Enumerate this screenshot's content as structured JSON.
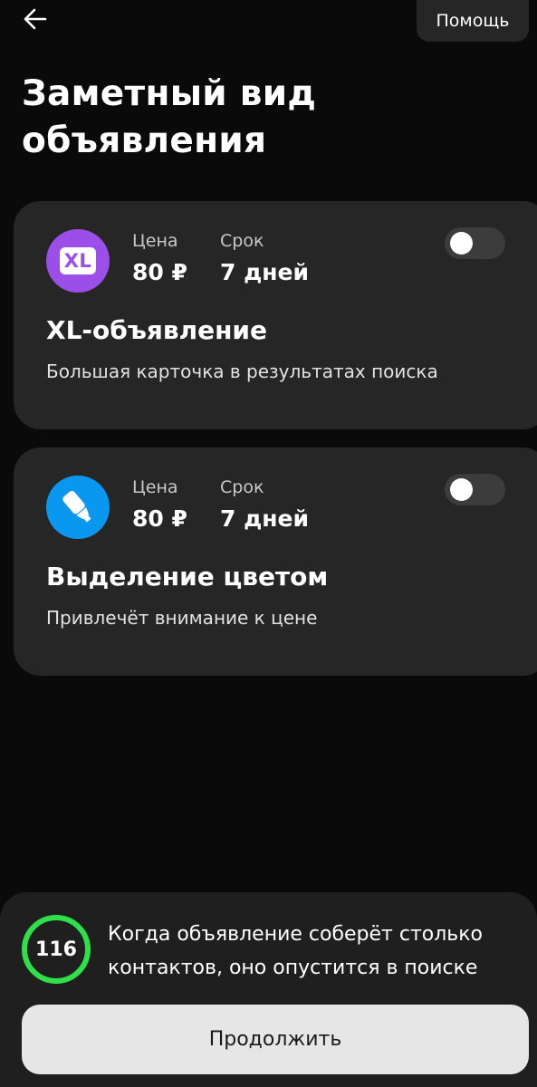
{
  "header": {
    "back_icon": "arrow-left-icon",
    "help_label": "Помощь"
  },
  "page": {
    "title": "Заметный вид объявления"
  },
  "options": [
    {
      "icon": "xl-badge-icon",
      "icon_text": "XL",
      "icon_color": "#9b4fe8",
      "price_label": "Цена",
      "price_value": "80 ₽",
      "term_label": "Срок",
      "term_value": "7 дней",
      "title": "XL-объявление",
      "description": "Большая карточка в результатах поиска",
      "enabled": false
    },
    {
      "icon": "highlighter-icon",
      "icon_color": "#0a97f0",
      "price_label": "Цена",
      "price_value": "80 ₽",
      "term_label": "Срок",
      "term_value": "7 дней",
      "title": "Выделение цветом",
      "description": "Привлечёт внимание к цене",
      "enabled": false
    }
  ],
  "footer": {
    "counter_value": "116",
    "counter_color": "#2ee04a",
    "notice": "Когда объявление соберёт столько контактов, оно опустится в поиске",
    "continue_label": "Продолжить"
  }
}
